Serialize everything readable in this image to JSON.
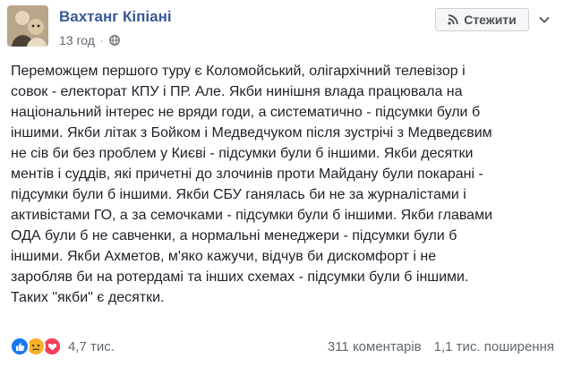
{
  "post": {
    "author": "Вахтанг Кіпіані",
    "time": "13 год",
    "separator": "·",
    "follow_label": "Стежити",
    "text_lines": [
      "Переможцем першого туру є Коломойський, олігархічний телевізор і",
      "совок - електорат КПУ і ПР. Але. Якби нинішня влада працювала на",
      "національний інтерес не вряди годи, а систематично - підсумки були б",
      "іншими. Якби літак з Бойком і Медведчуком після зустрічі з Медведєвим",
      "не сів би без проблем у Києві - підсумки були б іншими. Якби десятки",
      "ментів і суддів, які причетні до злочинів проти Майдану були покарані -",
      "підсумки були б іншими. Якби СБУ ганялась би не за журналістами і",
      "активістами ГО, а за семочками - підсумки були б іншими. Якби главами",
      "ОДА були б не савченки, а нормальні менеджери - підсумки були б",
      "іншими. Якби Ахметов, м'яко кажучи, відчув би дискомфорт і не",
      "заробляв би на ротердамі та інших схемах - підсумки були б іншими.",
      "Таких \"якби\" є десятки."
    ]
  },
  "footer": {
    "reactions": [
      "like",
      "sad",
      "love"
    ],
    "reaction_count": "4,7 тис.",
    "comments": "311 коментарів",
    "shares": "1,1 тис. поширення"
  },
  "colors": {
    "author_link": "#385898",
    "text": "#1d2129",
    "muted": "#616770",
    "like": "#1877f2",
    "sad": "#f7b125",
    "love": "#f33e58"
  },
  "icons": {
    "follow": "rss-icon",
    "privacy": "globe-icon",
    "menu": "chevron-down-icon"
  }
}
